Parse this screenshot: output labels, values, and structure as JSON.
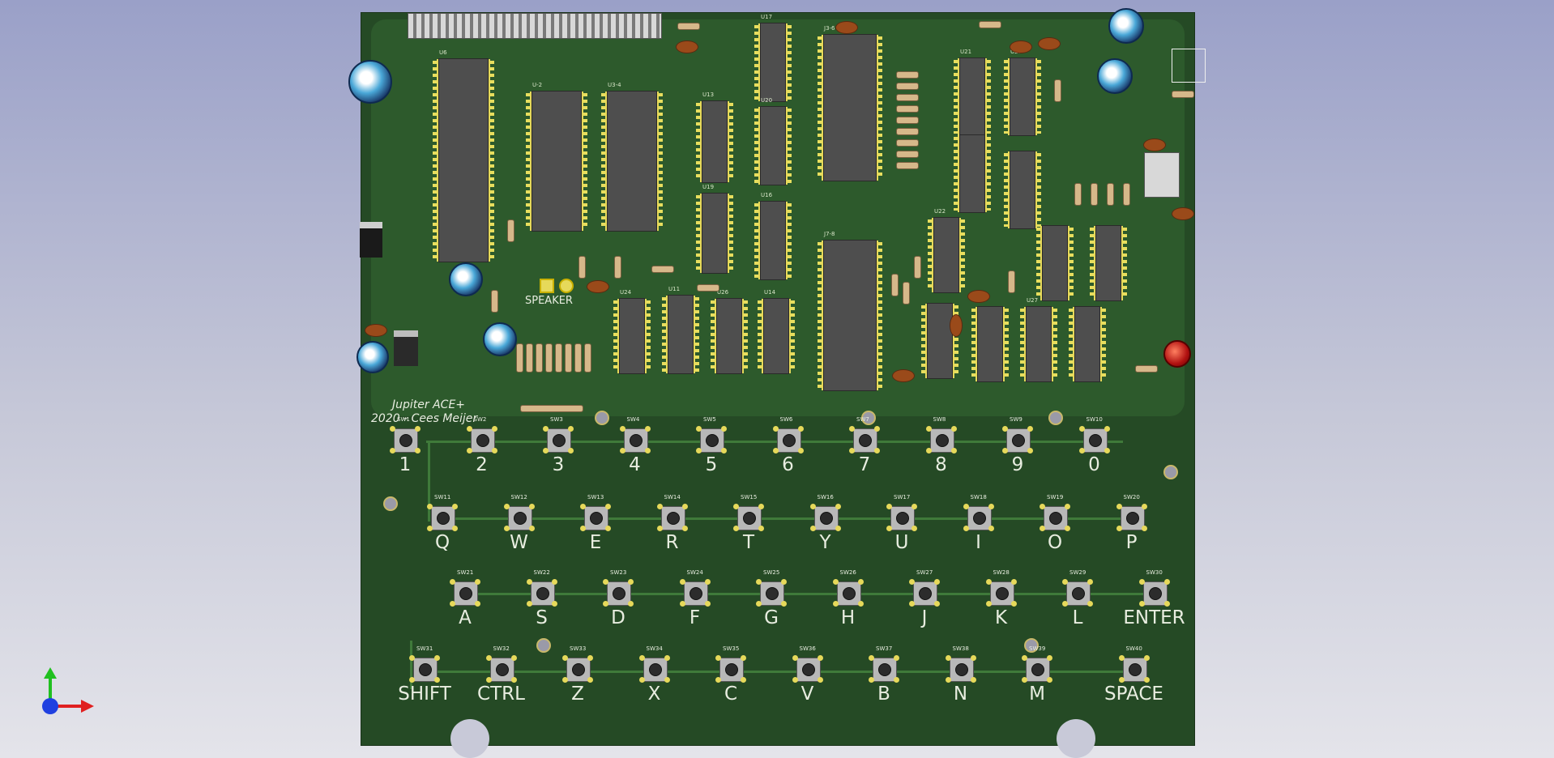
{
  "board": {
    "title": "Jupiter ACE+",
    "credit": "2020 - Cees Meijer",
    "speaker_label": "SPEAKER"
  },
  "ic_refs": [
    "U6",
    "U-2",
    "U3-4",
    "U13",
    "U17",
    "U20",
    "U19",
    "U16",
    "U11",
    "J3-6",
    "J7-8",
    "U24",
    "U26",
    "U14",
    "U22",
    "U21",
    "U25",
    "U27"
  ],
  "keyboard": {
    "rows": [
      {
        "keys": [
          {
            "ref": "SW1",
            "label": "1"
          },
          {
            "ref": "SW2",
            "label": "2"
          },
          {
            "ref": "SW3",
            "label": "3"
          },
          {
            "ref": "SW4",
            "label": "4"
          },
          {
            "ref": "SW5",
            "label": "5"
          },
          {
            "ref": "SW6",
            "label": "6"
          },
          {
            "ref": "SW7",
            "label": "7"
          },
          {
            "ref": "SW8",
            "label": "8"
          },
          {
            "ref": "SW9",
            "label": "9"
          },
          {
            "ref": "SW10",
            "label": "0"
          }
        ]
      },
      {
        "keys": [
          {
            "ref": "SW11",
            "label": "Q"
          },
          {
            "ref": "SW12",
            "label": "W"
          },
          {
            "ref": "SW13",
            "label": "E"
          },
          {
            "ref": "SW14",
            "label": "R"
          },
          {
            "ref": "SW15",
            "label": "T"
          },
          {
            "ref": "SW16",
            "label": "Y"
          },
          {
            "ref": "SW17",
            "label": "U"
          },
          {
            "ref": "SW18",
            "label": "I"
          },
          {
            "ref": "SW19",
            "label": "O"
          },
          {
            "ref": "SW20",
            "label": "P"
          }
        ]
      },
      {
        "keys": [
          {
            "ref": "SW21",
            "label": "A"
          },
          {
            "ref": "SW22",
            "label": "S"
          },
          {
            "ref": "SW23",
            "label": "D"
          },
          {
            "ref": "SW24",
            "label": "F"
          },
          {
            "ref": "SW25",
            "label": "G"
          },
          {
            "ref": "SW26",
            "label": "H"
          },
          {
            "ref": "SW27",
            "label": "J"
          },
          {
            "ref": "SW28",
            "label": "K"
          },
          {
            "ref": "SW29",
            "label": "L"
          },
          {
            "ref": "SW30",
            "label": "ENTER"
          }
        ]
      },
      {
        "keys": [
          {
            "ref": "SW31",
            "label": "SHIFT"
          },
          {
            "ref": "SW32",
            "label": "CTRL"
          },
          {
            "ref": "SW33",
            "label": "Z"
          },
          {
            "ref": "SW34",
            "label": "X"
          },
          {
            "ref": "SW35",
            "label": "C"
          },
          {
            "ref": "SW36",
            "label": "V"
          },
          {
            "ref": "SW37",
            "label": "B"
          },
          {
            "ref": "SW38",
            "label": "N"
          },
          {
            "ref": "SW39",
            "label": "M"
          },
          {
            "ref": "SW40",
            "label": "SPACE"
          }
        ]
      }
    ]
  },
  "axes_gizmo": {
    "x_color": "#e02020",
    "y_color": "#20c020",
    "z_color": "#2040e0"
  }
}
